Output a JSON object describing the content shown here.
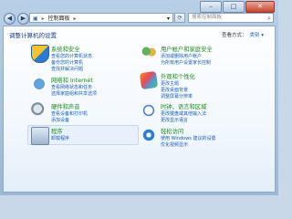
{
  "window": {
    "buttons": {
      "minimize": "–",
      "maximize": "□",
      "close": "✕"
    }
  },
  "nav": {
    "back": "◀",
    "forward": "▶"
  },
  "address": {
    "root": "控制面板",
    "separator": "▸",
    "dropdown": "▾"
  },
  "refresh_icon": "⟳",
  "search": {
    "placeholder": "搜索控制面板",
    "icon": "search-icon"
  },
  "heading": "调整计算机的设置",
  "view_by": {
    "label": "查看方式：",
    "value": "类别 ▾"
  },
  "categories": [
    {
      "title": "系统和安全",
      "links": [
        "查看您的计算机状态",
        "备份您的计算机",
        "查找并解决问题"
      ],
      "icon": "shield-icon",
      "color": "#1e8a1e"
    },
    {
      "title": "网络和 Internet",
      "links": [
        "查看网络状态和任务",
        "选择家庭组和共享选项"
      ],
      "icon": "network-icon",
      "color": "#1e8a1e"
    },
    {
      "title": "硬件和声音",
      "links": [
        "查看设备和打印机",
        "添加设备"
      ],
      "icon": "hardware-icon",
      "color": "#1e8a1e"
    },
    {
      "title": "程序",
      "links": [
        "卸载程序"
      ],
      "icon": "programs-icon",
      "color": "#1e8a1e"
    },
    {
      "title": "用户帐户和家庭安全",
      "links": [
        "添加或删除用户帐户",
        "为所有用户设置家长控制"
      ],
      "icon": "users-icon",
      "color": "#1e8a1e"
    },
    {
      "title": "外观和个性化",
      "links": [
        "更改主题",
        "更改桌面背景",
        "调整屏幕分辨率"
      ],
      "icon": "appearance-icon",
      "color": "#1e8a1e"
    },
    {
      "title": "时钟、语言和区域",
      "links": [
        "更改键盘或其他输入法",
        "更改显示语言"
      ],
      "icon": "clock-icon",
      "color": "#1e8a1e"
    },
    {
      "title": "轻松访问",
      "links": [
        "使用 Windows 建议的设置",
        "优化视频显示"
      ],
      "icon": "ease-of-access-icon",
      "color": "#1e8a1e"
    }
  ]
}
